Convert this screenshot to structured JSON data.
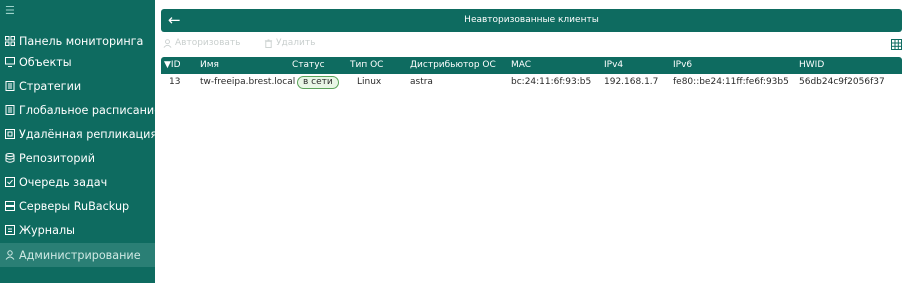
{
  "sidebar": {
    "top_icon": "collapse-icon",
    "items": [
      {
        "label": "Панель мониторинга",
        "icon": "dashboard-icon"
      },
      {
        "label": "Объекты",
        "icon": "monitor-icon"
      },
      {
        "label": "Стратегии",
        "icon": "document-icon"
      },
      {
        "label": "Глобальное расписание",
        "icon": "document-icon"
      },
      {
        "label": "Удалённая репликация",
        "icon": "replication-icon"
      },
      {
        "label": "Репозиторий",
        "icon": "database-icon"
      },
      {
        "label": "Очередь задач",
        "icon": "checklist-icon"
      },
      {
        "label": "Серверы RuBackup",
        "icon": "server-icon"
      },
      {
        "label": "Журналы",
        "icon": "journal-icon"
      },
      {
        "label": "Администрирование",
        "icon": "user-icon"
      }
    ],
    "active_index": 9
  },
  "header": {
    "title": "Неавторизованные клиенты",
    "back_icon": "back-arrow-icon"
  },
  "toolbar": {
    "authorize_label": "Авторизовать",
    "delete_label": "Удалить"
  },
  "table": {
    "sort_indicator": "▼",
    "columns": [
      "ID",
      "Имя",
      "Статус",
      "Тип ОС",
      "Дистрибьютор ОС",
      "MAC",
      "IPv4",
      "IPv6",
      "HWID"
    ],
    "rows": [
      {
        "id": "13",
        "name": "tw-freeipa.brest.local",
        "status": "в сети",
        "os_type": "Linux",
        "distributor": "astra",
        "mac": "bc:24:11:6f:93:b5",
        "ipv4": "192.168.1.7",
        "ipv6": "fe80::be24:11ff:fe6f:93b5",
        "hwid": "56db24c9f2056f37"
      }
    ]
  },
  "colors": {
    "primary": "#0e6b60",
    "active_item": "#2a7f75",
    "status_border": "#5aa35a",
    "status_bg": "#e9f6e6"
  }
}
